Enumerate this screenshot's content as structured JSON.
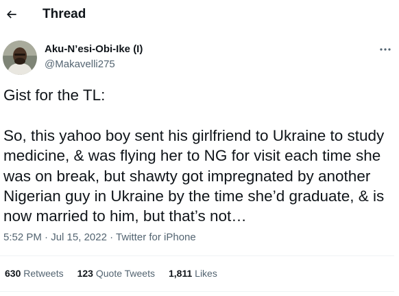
{
  "header": {
    "title": "Thread",
    "back_icon": "arrow-left-icon"
  },
  "tweet": {
    "author": {
      "display_name": "Aku-N’esi-Obi-Ike (I)",
      "handle": "@Makavelli275",
      "avatar": "profile-photo"
    },
    "more_icon": "more-horizontal-icon",
    "text": "Gist for the TL:\n\nSo, this yahoo boy sent his girlfriend to Ukraine to study medicine, & was flying her to NG for visit each time she was on break, but shawty got impregnated by another Nigerian guy in Ukraine by the time she’d graduate, & is now married to him, but that’s not…",
    "time": "5:52 PM",
    "sep": " · ",
    "date": "Jul 15, 2022",
    "source": "Twitter for iPhone",
    "stats": {
      "retweets": {
        "count": "630",
        "label": "Retweets"
      },
      "quotes": {
        "count": "123",
        "label": "Quote Tweets"
      },
      "likes": {
        "count": "1,811",
        "label": "Likes"
      }
    }
  },
  "colors": {
    "text_primary": "#0f1419",
    "text_secondary": "#536471",
    "divider": "#eff3f4",
    "background": "#ffffff"
  }
}
